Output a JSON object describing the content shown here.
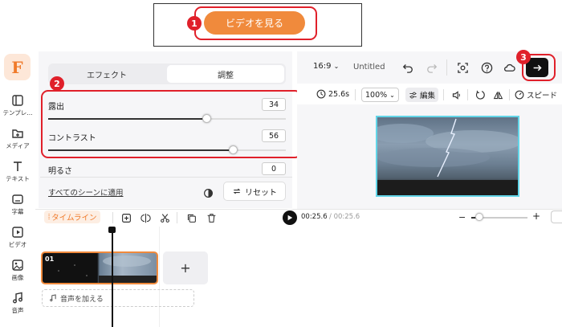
{
  "banner": {
    "watch_button": "ビデオを見る"
  },
  "badges": {
    "b1": "1",
    "b2": "2",
    "b3": "3"
  },
  "sidebar": {
    "logo": "F",
    "items": [
      {
        "label": "テンプレ..."
      },
      {
        "label": "メディア"
      },
      {
        "label": "テキスト"
      },
      {
        "label": "字幕"
      },
      {
        "label": "ビデオ"
      },
      {
        "label": "画像"
      },
      {
        "label": "音声"
      }
    ]
  },
  "panel": {
    "tabs": [
      {
        "label": "エフェクト"
      },
      {
        "label": "調整"
      }
    ],
    "sliders": [
      {
        "label": "露出",
        "value": "34",
        "level": 0.34
      },
      {
        "label": "コントラスト",
        "value": "56",
        "level": 0.56
      },
      {
        "label": "明るさ",
        "value": "0",
        "level": 0
      }
    ],
    "apply_all": "すべてのシーンに適用",
    "reset": "リセット"
  },
  "topbar": {
    "ratio": "16:9",
    "title": "Untitled"
  },
  "toolbar2": {
    "duration": "25.6s",
    "zoom": "100%",
    "edit": "編集",
    "speed": "スピード"
  },
  "timeline": {
    "label": "タイムライン",
    "current": "00:25.6",
    "total": "/ 00:25.6",
    "clip_number": "01",
    "add_audio": "音声を加える",
    "add_clip": "+"
  },
  "colors": {
    "accent": "#f08a3c",
    "highlight": "#e0202a",
    "preview_border": "#62d5e8"
  }
}
